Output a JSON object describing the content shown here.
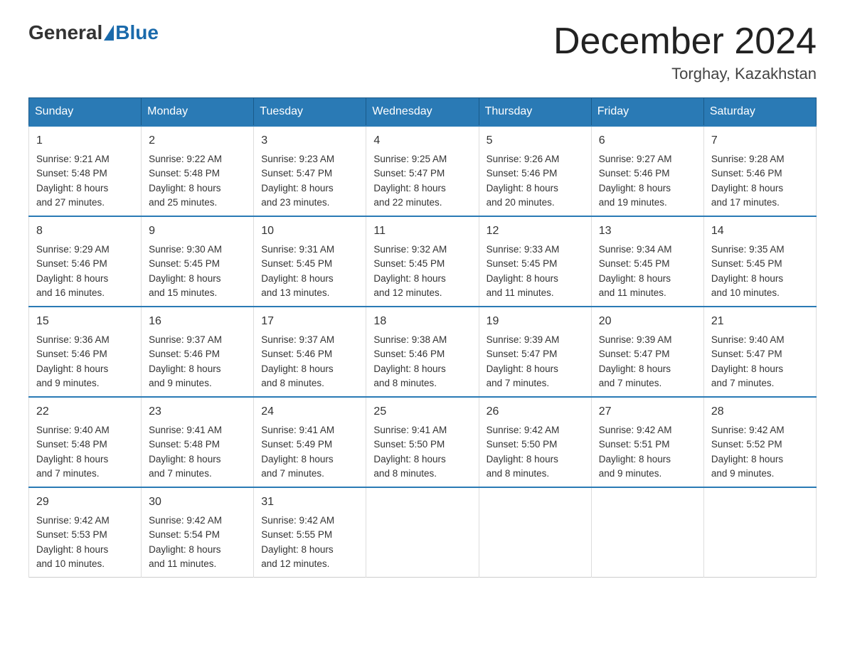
{
  "header": {
    "logo_general": "General",
    "logo_blue": "Blue",
    "main_title": "December 2024",
    "subtitle": "Torghay, Kazakhstan"
  },
  "days": [
    "Sunday",
    "Monday",
    "Tuesday",
    "Wednesday",
    "Thursday",
    "Friday",
    "Saturday"
  ],
  "weeks": [
    [
      {
        "num": "1",
        "sunrise": "9:21 AM",
        "sunset": "5:48 PM",
        "daylight": "8 hours and 27 minutes."
      },
      {
        "num": "2",
        "sunrise": "9:22 AM",
        "sunset": "5:48 PM",
        "daylight": "8 hours and 25 minutes."
      },
      {
        "num": "3",
        "sunrise": "9:23 AM",
        "sunset": "5:47 PM",
        "daylight": "8 hours and 23 minutes."
      },
      {
        "num": "4",
        "sunrise": "9:25 AM",
        "sunset": "5:47 PM",
        "daylight": "8 hours and 22 minutes."
      },
      {
        "num": "5",
        "sunrise": "9:26 AM",
        "sunset": "5:46 PM",
        "daylight": "8 hours and 20 minutes."
      },
      {
        "num": "6",
        "sunrise": "9:27 AM",
        "sunset": "5:46 PM",
        "daylight": "8 hours and 19 minutes."
      },
      {
        "num": "7",
        "sunrise": "9:28 AM",
        "sunset": "5:46 PM",
        "daylight": "8 hours and 17 minutes."
      }
    ],
    [
      {
        "num": "8",
        "sunrise": "9:29 AM",
        "sunset": "5:46 PM",
        "daylight": "8 hours and 16 minutes."
      },
      {
        "num": "9",
        "sunrise": "9:30 AM",
        "sunset": "5:45 PM",
        "daylight": "8 hours and 15 minutes."
      },
      {
        "num": "10",
        "sunrise": "9:31 AM",
        "sunset": "5:45 PM",
        "daylight": "8 hours and 13 minutes."
      },
      {
        "num": "11",
        "sunrise": "9:32 AM",
        "sunset": "5:45 PM",
        "daylight": "8 hours and 12 minutes."
      },
      {
        "num": "12",
        "sunrise": "9:33 AM",
        "sunset": "5:45 PM",
        "daylight": "8 hours and 11 minutes."
      },
      {
        "num": "13",
        "sunrise": "9:34 AM",
        "sunset": "5:45 PM",
        "daylight": "8 hours and 11 minutes."
      },
      {
        "num": "14",
        "sunrise": "9:35 AM",
        "sunset": "5:45 PM",
        "daylight": "8 hours and 10 minutes."
      }
    ],
    [
      {
        "num": "15",
        "sunrise": "9:36 AM",
        "sunset": "5:46 PM",
        "daylight": "8 hours and 9 minutes."
      },
      {
        "num": "16",
        "sunrise": "9:37 AM",
        "sunset": "5:46 PM",
        "daylight": "8 hours and 9 minutes."
      },
      {
        "num": "17",
        "sunrise": "9:37 AM",
        "sunset": "5:46 PM",
        "daylight": "8 hours and 8 minutes."
      },
      {
        "num": "18",
        "sunrise": "9:38 AM",
        "sunset": "5:46 PM",
        "daylight": "8 hours and 8 minutes."
      },
      {
        "num": "19",
        "sunrise": "9:39 AM",
        "sunset": "5:47 PM",
        "daylight": "8 hours and 7 minutes."
      },
      {
        "num": "20",
        "sunrise": "9:39 AM",
        "sunset": "5:47 PM",
        "daylight": "8 hours and 7 minutes."
      },
      {
        "num": "21",
        "sunrise": "9:40 AM",
        "sunset": "5:47 PM",
        "daylight": "8 hours and 7 minutes."
      }
    ],
    [
      {
        "num": "22",
        "sunrise": "9:40 AM",
        "sunset": "5:48 PM",
        "daylight": "8 hours and 7 minutes."
      },
      {
        "num": "23",
        "sunrise": "9:41 AM",
        "sunset": "5:48 PM",
        "daylight": "8 hours and 7 minutes."
      },
      {
        "num": "24",
        "sunrise": "9:41 AM",
        "sunset": "5:49 PM",
        "daylight": "8 hours and 7 minutes."
      },
      {
        "num": "25",
        "sunrise": "9:41 AM",
        "sunset": "5:50 PM",
        "daylight": "8 hours and 8 minutes."
      },
      {
        "num": "26",
        "sunrise": "9:42 AM",
        "sunset": "5:50 PM",
        "daylight": "8 hours and 8 minutes."
      },
      {
        "num": "27",
        "sunrise": "9:42 AM",
        "sunset": "5:51 PM",
        "daylight": "8 hours and 9 minutes."
      },
      {
        "num": "28",
        "sunrise": "9:42 AM",
        "sunset": "5:52 PM",
        "daylight": "8 hours and 9 minutes."
      }
    ],
    [
      {
        "num": "29",
        "sunrise": "9:42 AM",
        "sunset": "5:53 PM",
        "daylight": "8 hours and 10 minutes."
      },
      {
        "num": "30",
        "sunrise": "9:42 AM",
        "sunset": "5:54 PM",
        "daylight": "8 hours and 11 minutes."
      },
      {
        "num": "31",
        "sunrise": "9:42 AM",
        "sunset": "5:55 PM",
        "daylight": "8 hours and 12 minutes."
      },
      null,
      null,
      null,
      null
    ]
  ],
  "labels": {
    "sunrise": "Sunrise:",
    "sunset": "Sunset:",
    "daylight": "Daylight:"
  }
}
